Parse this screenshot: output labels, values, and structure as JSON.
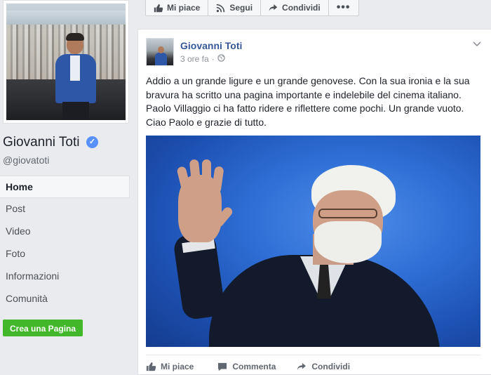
{
  "page": {
    "name": "Giovanni Toti",
    "handle": "@giovatoti",
    "verified_icon": "check-icon"
  },
  "nav": {
    "items": [
      {
        "label": "Home",
        "active": true
      },
      {
        "label": "Post"
      },
      {
        "label": "Video"
      },
      {
        "label": "Foto"
      },
      {
        "label": "Informazioni"
      },
      {
        "label": "Comunità"
      }
    ],
    "create_page_label": "Crea una Pagina"
  },
  "action_bar": {
    "like_label": "Mi piace",
    "follow_label": "Segui",
    "share_label": "Condividi",
    "more_label": "•••"
  },
  "post": {
    "author": "Giovanni Toti",
    "time": "3 ore fa",
    "separator": "·",
    "text": "Addio a un grande ligure e un grande genovese. Con la sua ironia e la sua bravura ha scritto una pagina importante e indelebile del cinema italiano. Paolo Villaggio ci ha fatto ridere e riflettere come pochi. Un grande vuoto. Ciao Paolo e grazie di tutto.",
    "actions": {
      "like_label": "Mi piace",
      "comment_label": "Commenta",
      "share_label": "Condividi"
    }
  },
  "colors": {
    "link_blue": "#365899",
    "create_green": "#42b72a",
    "verified_blue": "#5890ff"
  }
}
